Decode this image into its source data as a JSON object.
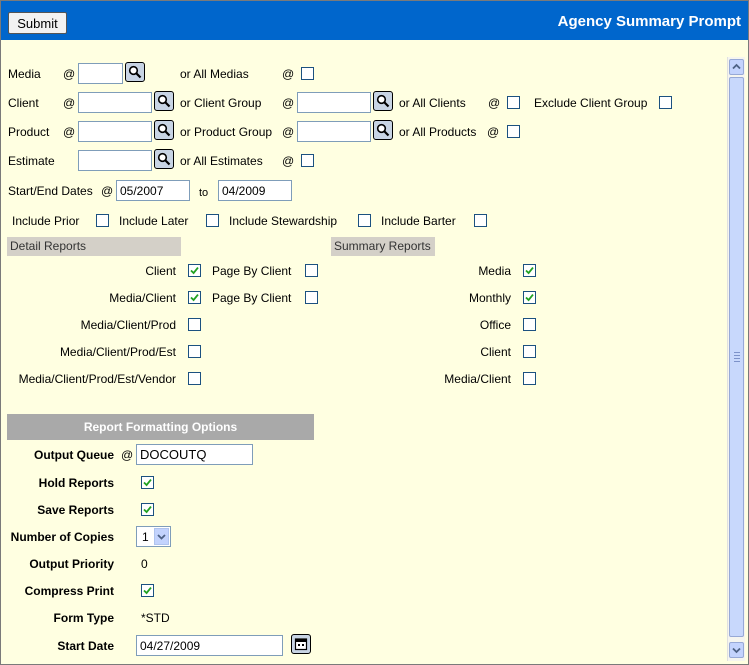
{
  "header": {
    "submit_label": "Submit",
    "title": "Agency Summary Prompt"
  },
  "filters": {
    "at": "@",
    "media_label": "Media",
    "all_medias_label": "or All Medias",
    "client_label": "Client",
    "client_group_label": "or Client Group",
    "all_clients_label": "or All Clients",
    "exclude_client_group_label": "Exclude Client Group",
    "product_label": "Product",
    "product_group_label": "or Product Group",
    "all_products_label": "or All Products",
    "estimate_label": "Estimate",
    "all_estimates_label": "or All Estimates",
    "start_end_label": "Start/End Dates",
    "start_date_value": "05/2007",
    "to_label": "to",
    "end_date_value": "04/2009",
    "include_prior_label": "Include Prior",
    "include_later_label": "Include Later",
    "include_stewardship_label": "Include Stewardship",
    "include_barter_label": "Include Barter"
  },
  "detail_reports": {
    "header": "Detail Reports",
    "items": [
      {
        "label": "Client",
        "checked": true,
        "page_by_client_label": "Page By Client",
        "page_by_checked": false
      },
      {
        "label": "Media/Client",
        "checked": true,
        "page_by_client_label": "Page By Client",
        "page_by_checked": false
      },
      {
        "label": "Media/Client/Prod",
        "checked": false
      },
      {
        "label": "Media/Client/Prod/Est",
        "checked": false
      },
      {
        "label": "Media/Client/Prod/Est/Vendor",
        "checked": false
      }
    ]
  },
  "summary_reports": {
    "header": "Summary Reports",
    "items": [
      {
        "label": "Media",
        "checked": true
      },
      {
        "label": "Monthly",
        "checked": true
      },
      {
        "label": "Office",
        "checked": false
      },
      {
        "label": "Client",
        "checked": false
      },
      {
        "label": "Media/Client",
        "checked": false
      }
    ]
  },
  "formatting": {
    "header": "Report Formatting Options",
    "output_queue_label": "Output Queue",
    "output_queue_at": "@",
    "output_queue_value": "DOCOUTQ",
    "hold_reports_label": "Hold Reports",
    "hold_reports_checked": true,
    "save_reports_label": "Save Reports",
    "save_reports_checked": true,
    "copies_label": "Number of Copies",
    "copies_value": "1",
    "priority_label": "Output Priority",
    "priority_value": "0",
    "compress_label": "Compress Print",
    "compress_checked": true,
    "form_type_label": "Form Type",
    "form_type_value": "*STD",
    "start_date_label": "Start Date",
    "start_date_value": "04/27/2009"
  },
  "icons": {
    "lookup": "magnifier-lookup-icon",
    "calendar": "calendar-icon",
    "check": "checkmark-icon"
  },
  "colors": {
    "header_bg": "#0066cc",
    "page_bg": "#ffffe1",
    "section_bg": "#d4d0c8",
    "fmt_header_bg": "#a9a9a9",
    "check": "#21a121"
  }
}
